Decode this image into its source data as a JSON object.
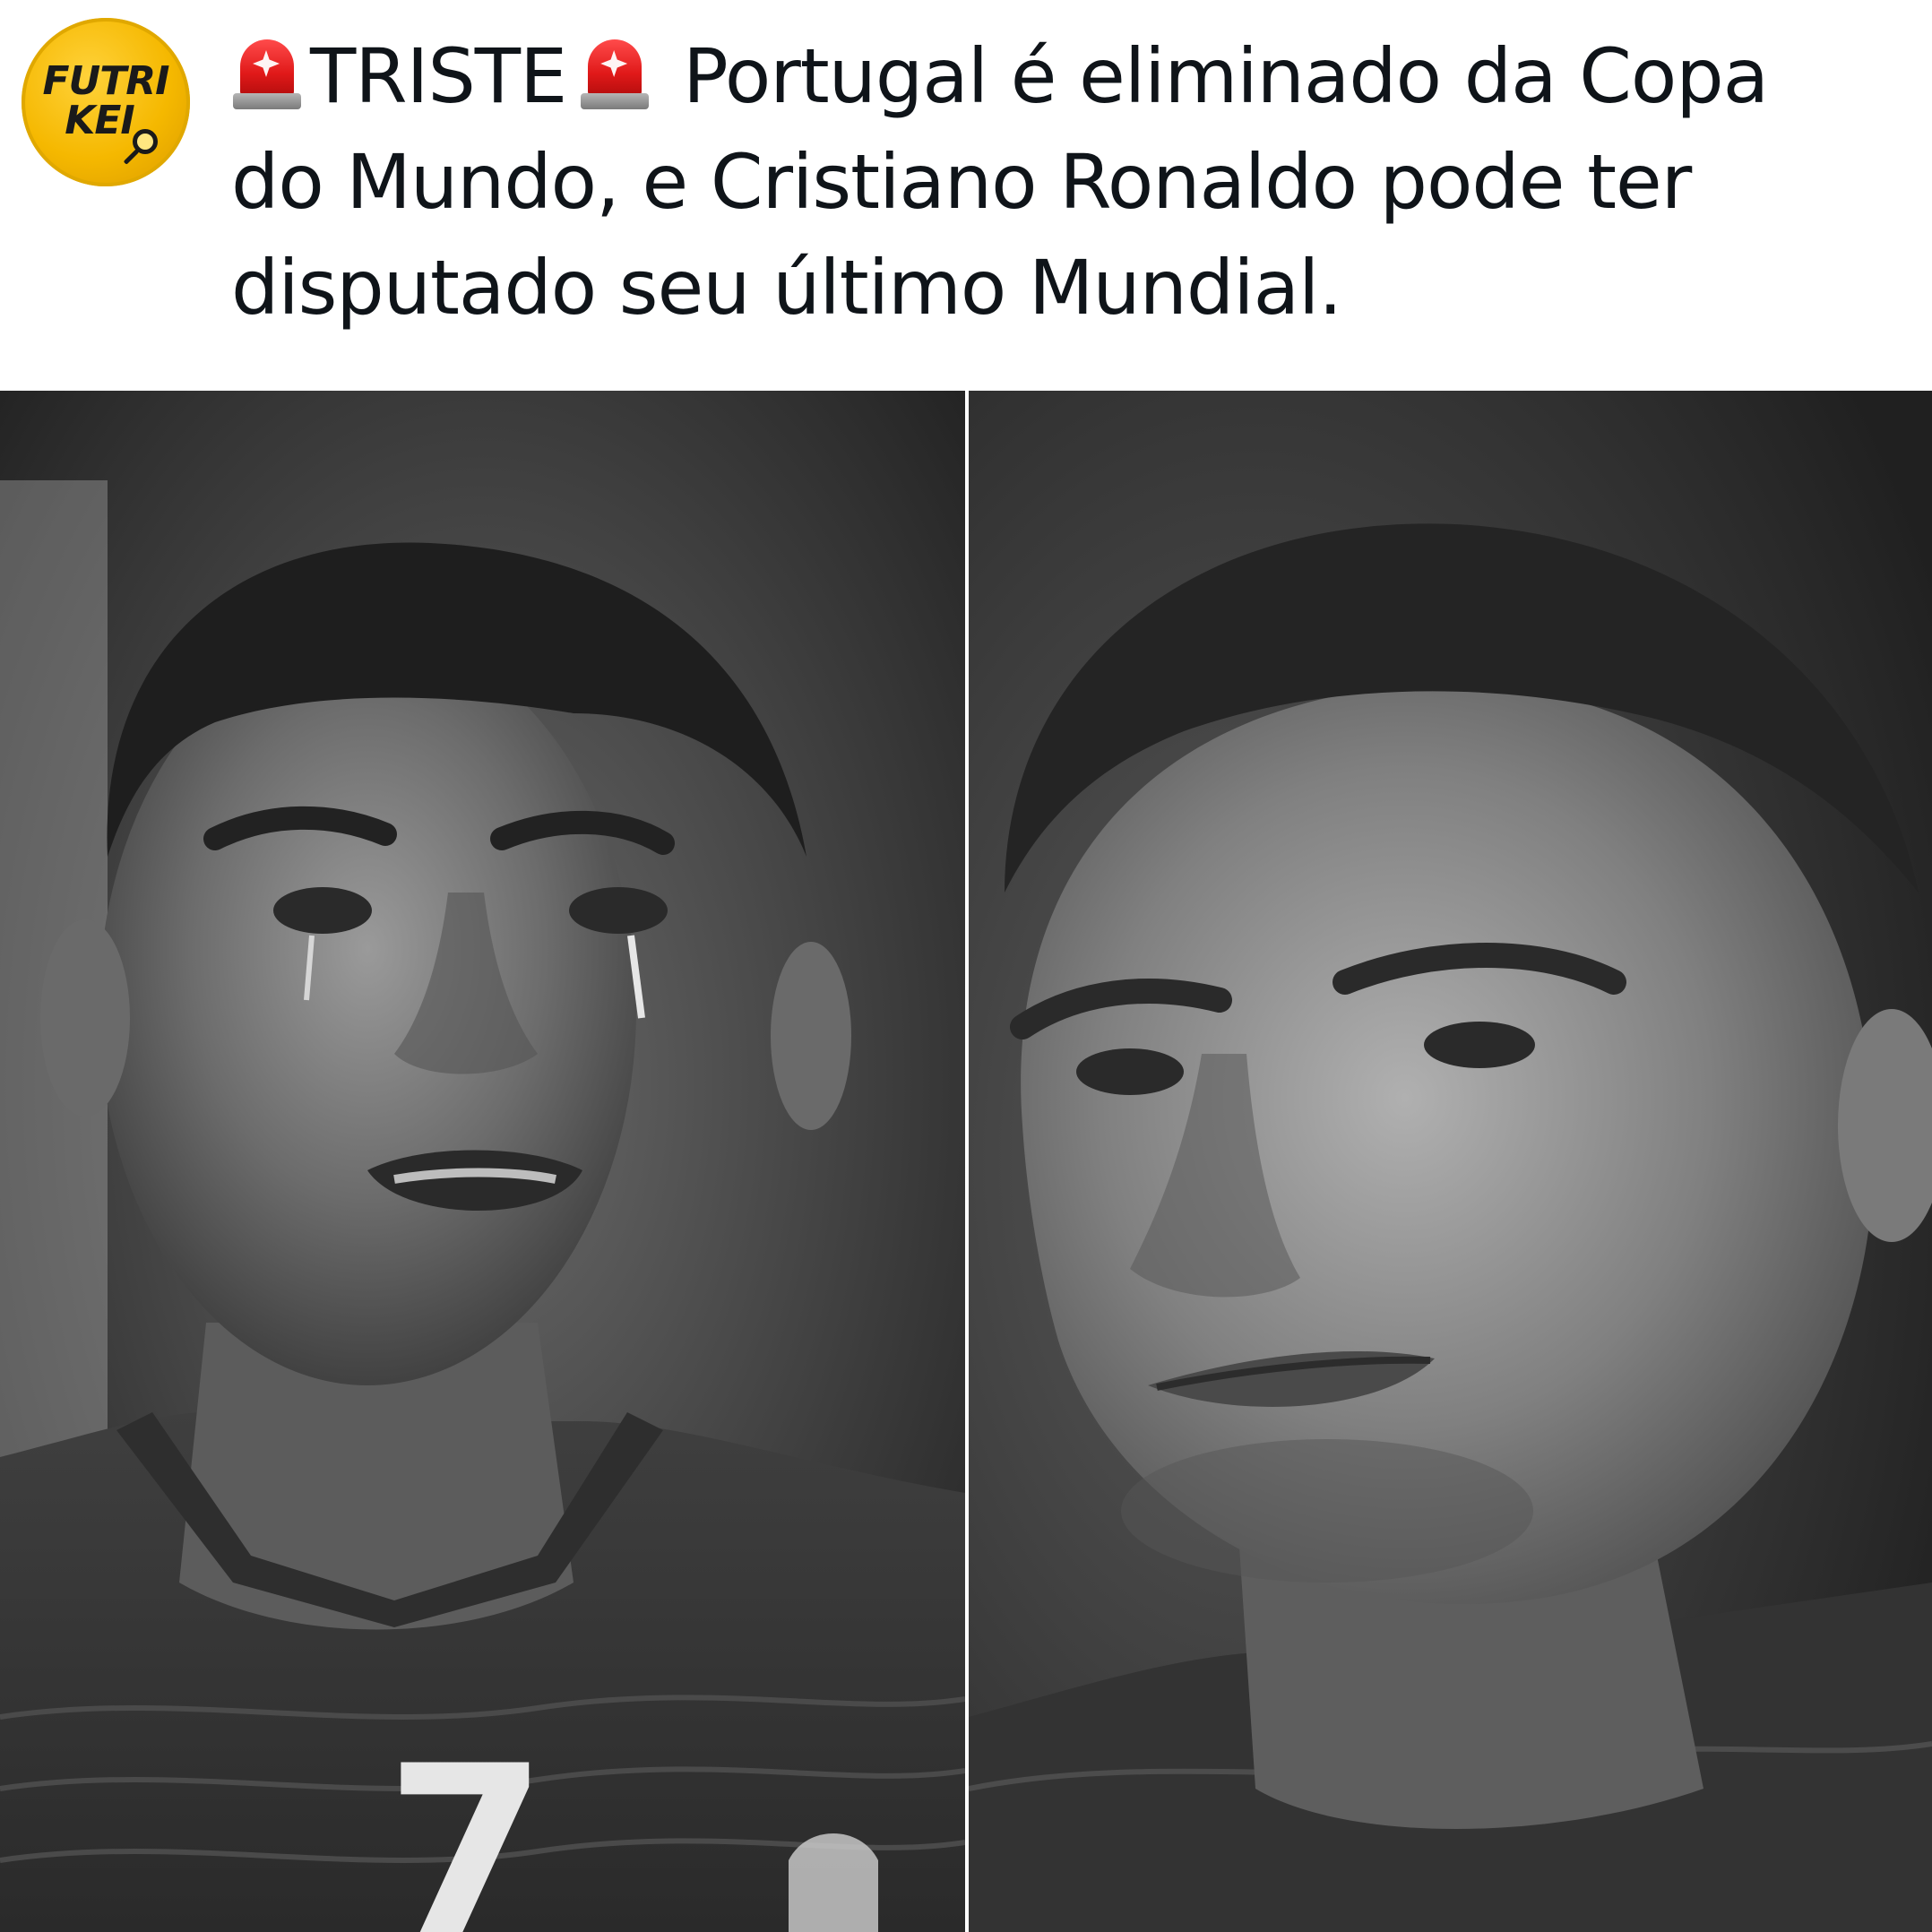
{
  "account": {
    "avatar_line1": "FUTRI",
    "avatar_line2": "KEI"
  },
  "post": {
    "highlight": "TRISTE",
    "line1_rest": "Portugal é eliminado da Copa",
    "line2": "do Mundo, e Cristiano Ronaldo pode ter",
    "line3": "disputado seu último Mundial."
  },
  "photos": {
    "left": {
      "jersey_number": "7"
    },
    "right": {}
  },
  "icons": {
    "siren": "police-siren-icon",
    "avatar_mark": "magnifier-icon"
  },
  "colors": {
    "avatar_yellow": "#f5b800",
    "siren_red": "#e01919",
    "text": "#0f1419",
    "background": "#ffffff"
  }
}
